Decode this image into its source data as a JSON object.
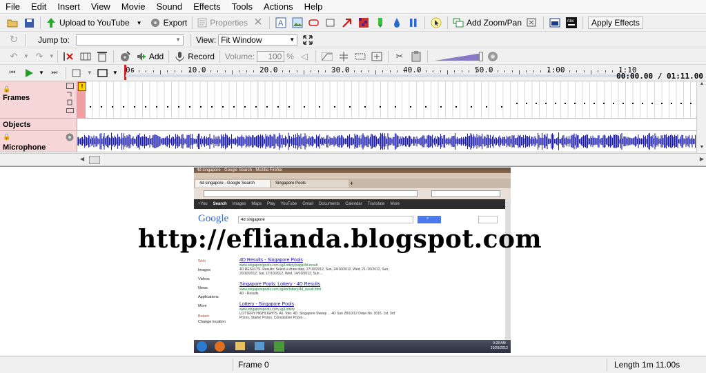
{
  "menu": [
    "File",
    "Edit",
    "Insert",
    "View",
    "Movie",
    "Sound",
    "Effects",
    "Tools",
    "Actions",
    "Help"
  ],
  "toolbar1": {
    "upload": "Upload to YouTube",
    "export": "Export",
    "properties": "Properties",
    "add_zoom_pan": "Add Zoom/Pan",
    "apply_effects": "Apply Effects"
  },
  "toolbar2": {
    "jump_to_label": "Jump to:",
    "jump_to_value": "",
    "view_label": "View:",
    "view_value": "Fit Window"
  },
  "toolbar3": {
    "add": "Add",
    "record": "Record",
    "volume_label": "Volume:",
    "volume_value": "100",
    "volume_unit": "%"
  },
  "ruler": {
    "ticks": [
      "0s",
      "10.0",
      "20.0",
      "30.0",
      "40.0",
      "50.0",
      "1:00",
      "1:10"
    ],
    "time_readout": "00:00.00 / 01:11.00"
  },
  "tracks": {
    "frames": "Frames",
    "objects": "Objects",
    "microphone": "Microphone"
  },
  "preview": {
    "window_title": "4d singapore - Google Search - Mozilla Firefox",
    "tab1": "4d singapore - Google Search",
    "tab2": "Singapore Pools",
    "search_query": "4d singapore",
    "search_button": "",
    "google_logo": "Google",
    "nav": [
      "+You",
      "Search",
      "Images",
      "Maps",
      "Play",
      "YouTube",
      "Gmail",
      "Documents",
      "Calendar",
      "Translate",
      "More"
    ],
    "results": [
      {
        "title": "4D Results - Singapore Pools",
        "url": "www.singaporepools.com.sg/Lottery/page/4d.result",
        "desc": "4D RESULTS. Results: Select a draw date, 27/10/2012, Sun, 24/10/2012, Wed, 21 /10/2012, Sun, 20/10/2012, Sat, 17/10/2012, Wed, 14/10/2012, Sun ..."
      },
      {
        "title": "Singapore Pools: Lottery - 4D Results",
        "url": "www.singaporepools.com.sg/en/lottery/4d_result.html",
        "desc": "4D - Results"
      },
      {
        "title": "Lottery - Singapore Pools",
        "url": "www.singaporepools.com.sg/Lottery",
        "desc": "LOTTERY HIGHLIGHTS. All. Toto. 4D. Singapore Sweep ... 4D Sun 28/10/12 Draw No. 3015. 1st. 3rd Prizes, Starter Prizes, Consolation Prizes ..."
      }
    ],
    "side": [
      "Web",
      "Images",
      "Videos",
      "News",
      "Applications",
      "More"
    ],
    "side_loc": [
      "Batam",
      "Change location"
    ],
    "clock": "9:28 AM",
    "date": "10/28/2012"
  },
  "watermark": "http://eflianda.blogspot.com",
  "status": {
    "frame": "Frame 0",
    "length": "Length 1m 11.00s"
  },
  "colors": {
    "waveform": "#1a1aa8",
    "track_head": "#f6d6d6",
    "link": "#1a0dab"
  }
}
